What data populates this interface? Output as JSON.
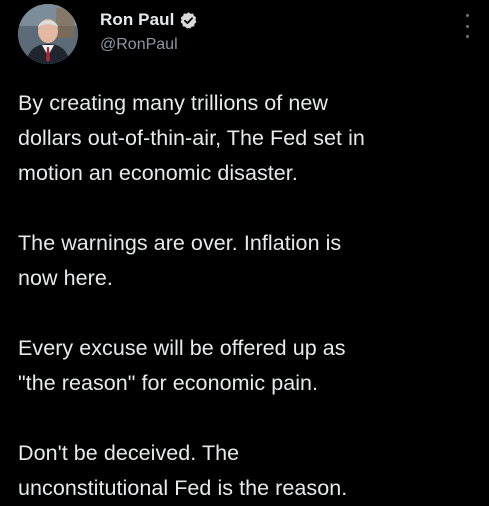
{
  "author": {
    "display_name": "Ron Paul",
    "handle": "@RonPaul",
    "verified": true,
    "avatar_icon": "profile-photo"
  },
  "colors": {
    "background": "#000000",
    "text_primary": "#e7e9ea",
    "text_secondary": "#8b98a5",
    "verified_badge": "#d9d9d9"
  },
  "icons": {
    "verified": "verified-badge-icon",
    "more": "more-options-icon"
  },
  "tweet": {
    "paragraphs": [
      "By creating many trillions of new\ndollars out-of-thin-air, The Fed set in\nmotion an economic disaster.",
      "The warnings are over. Inflation is\nnow here.",
      "Every excuse will be offered up as\n\"the reason\" for economic pain.",
      "Don't be deceived. The\nunconstitutional Fed is the reason."
    ]
  }
}
